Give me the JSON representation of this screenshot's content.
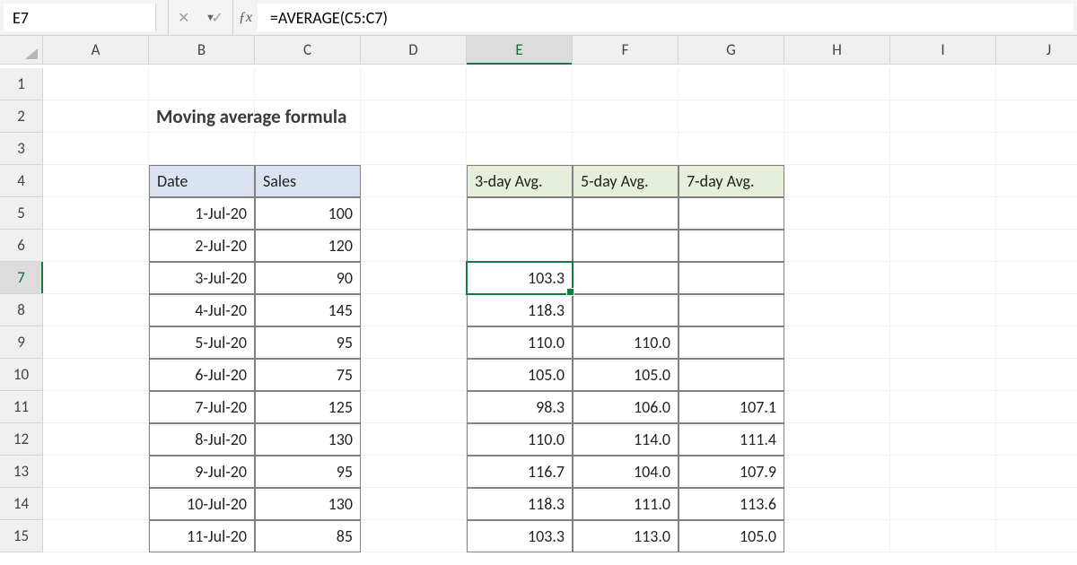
{
  "formula_bar": {
    "cell_ref": "E7",
    "formula": "=AVERAGE(C5:C7)"
  },
  "columns": [
    "A",
    "B",
    "C",
    "D",
    "E",
    "F",
    "G",
    "H",
    "I",
    "J"
  ],
  "row_labels": [
    "1",
    "2",
    "3",
    "4",
    "5",
    "6",
    "7",
    "8",
    "9",
    "10",
    "11",
    "12",
    "13",
    "14",
    "15"
  ],
  "title": "Moving average formula",
  "selected_col": "E",
  "selected_row": "7",
  "input_headers": {
    "date": "Date",
    "sales": "Sales"
  },
  "output_headers": {
    "avg3": "3-day Avg.",
    "avg5": "5-day Avg.",
    "avg7": "7-day Avg."
  },
  "data_rows": [
    {
      "date": "1-Jul-20",
      "sales": "100",
      "avg3": "",
      "avg5": "",
      "avg7": ""
    },
    {
      "date": "2-Jul-20",
      "sales": "120",
      "avg3": "",
      "avg5": "",
      "avg7": ""
    },
    {
      "date": "3-Jul-20",
      "sales": "90",
      "avg3": "103.3",
      "avg5": "",
      "avg7": ""
    },
    {
      "date": "4-Jul-20",
      "sales": "145",
      "avg3": "118.3",
      "avg5": "",
      "avg7": ""
    },
    {
      "date": "5-Jul-20",
      "sales": "95",
      "avg3": "110.0",
      "avg5": "110.0",
      "avg7": ""
    },
    {
      "date": "6-Jul-20",
      "sales": "75",
      "avg3": "105.0",
      "avg5": "105.0",
      "avg7": ""
    },
    {
      "date": "7-Jul-20",
      "sales": "125",
      "avg3": "98.3",
      "avg5": "106.0",
      "avg7": "107.1"
    },
    {
      "date": "8-Jul-20",
      "sales": "130",
      "avg3": "110.0",
      "avg5": "114.0",
      "avg7": "111.4"
    },
    {
      "date": "9-Jul-20",
      "sales": "95",
      "avg3": "116.7",
      "avg5": "104.0",
      "avg7": "107.9"
    },
    {
      "date": "10-Jul-20",
      "sales": "130",
      "avg3": "118.3",
      "avg5": "111.0",
      "avg7": "113.6"
    },
    {
      "date": "11-Jul-20",
      "sales": "85",
      "avg3": "103.3",
      "avg5": "113.0",
      "avg7": "105.0"
    }
  ]
}
